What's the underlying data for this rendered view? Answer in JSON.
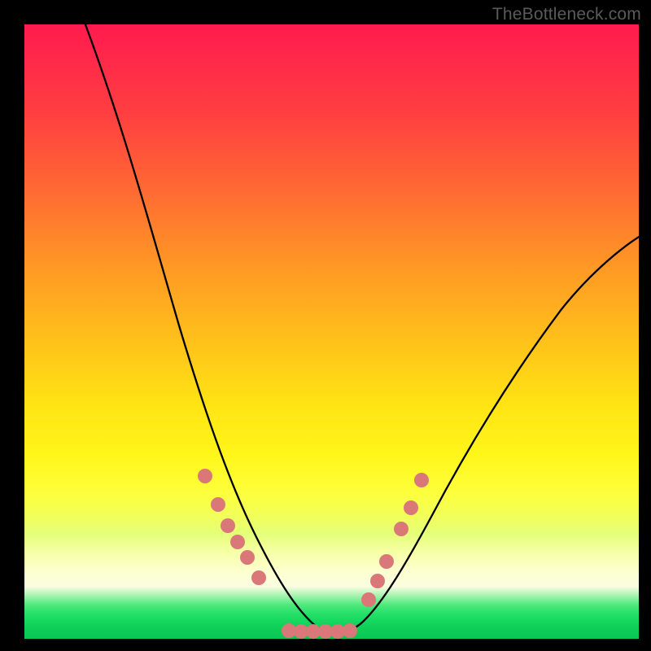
{
  "watermark": "TheBottleneck.com",
  "chart_data": {
    "type": "line",
    "title": "",
    "xlabel": "",
    "ylabel": "",
    "xlim": [
      0,
      100
    ],
    "ylim": [
      0,
      100
    ],
    "grid": false,
    "legend": false,
    "series": [
      {
        "name": "left-curve",
        "x": [
          10,
          15,
          20,
          24,
          28,
          32,
          35,
          38,
          40,
          42,
          44,
          46,
          48
        ],
        "y": [
          100,
          88,
          74,
          62,
          50,
          38,
          28,
          19,
          13,
          8,
          4,
          1,
          0
        ]
      },
      {
        "name": "right-curve",
        "x": [
          52,
          54,
          56,
          58,
          61,
          65,
          70,
          76,
          84,
          92,
          100
        ],
        "y": [
          0,
          1,
          3,
          6,
          10,
          16,
          24,
          33,
          44,
          55,
          65
        ]
      }
    ],
    "markers": [
      {
        "name": "left-dots",
        "x": [
          30.0,
          32.0,
          33.5,
          35.0,
          36.5,
          38.2
        ],
        "y": [
          26.0,
          21.5,
          18.0,
          15.5,
          13.0,
          9.5
        ],
        "color": "#d97779"
      },
      {
        "name": "bottom-dots",
        "x": [
          43.0,
          45.0,
          47.0,
          49.0,
          51.0,
          53.0
        ],
        "y": [
          0.7,
          0.7,
          0.7,
          0.7,
          0.7,
          0.7
        ],
        "color": "#d97779"
      },
      {
        "name": "right-dots",
        "x": [
          56.0,
          57.5,
          59.0,
          61.5,
          63.0,
          64.5
        ],
        "y": [
          6.0,
          9.0,
          12.0,
          17.5,
          21.0,
          25.5
        ],
        "color": "#d97779"
      }
    ],
    "background_gradient": {
      "top": "#ff1a4d",
      "mid": "#ffe414",
      "band_light": "#fafde0",
      "bottom": "#0ac755"
    }
  }
}
